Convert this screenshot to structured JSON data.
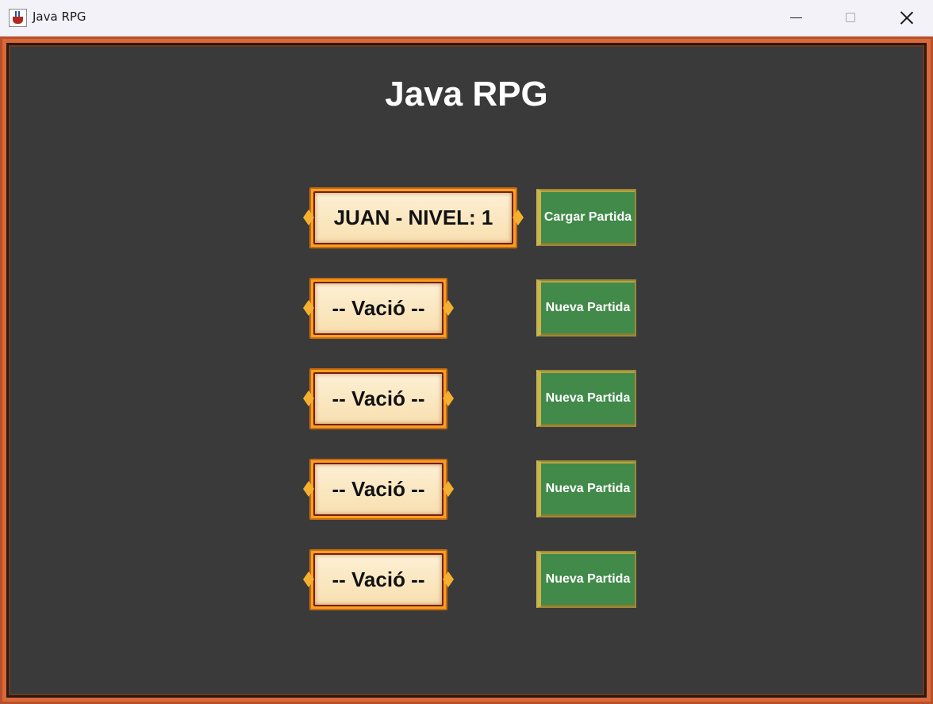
{
  "window": {
    "title": "Java RPG"
  },
  "game": {
    "title": "Java RPG"
  },
  "slots": [
    {
      "label": "JUAN - NIVEL: 1",
      "action": "Cargar Partida"
    },
    {
      "label": "-- Vació --",
      "action": "Nueva Partida"
    },
    {
      "label": "-- Vació --",
      "action": "Nueva Partida"
    },
    {
      "label": "-- Vació --",
      "action": "Nueva Partida"
    },
    {
      "label": "-- Vació --",
      "action": "Nueva Partida"
    }
  ],
  "colors": {
    "background": "#3a3a3a",
    "frame": "#d9683a",
    "action_button": "#418a4a",
    "plaque_gold": "#f5a021",
    "plaque_paper": "#fdf0d4"
  }
}
